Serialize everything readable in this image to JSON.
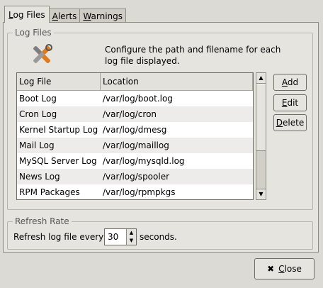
{
  "tabs": [
    {
      "label_ul": "L",
      "label_rest": "og Files"
    },
    {
      "label_ul": "A",
      "label_rest": "lerts"
    },
    {
      "label_ul": "W",
      "label_rest": "arnings"
    }
  ],
  "log_files_group": {
    "title": "Log Files",
    "description": "Configure the path and filename for each log file displayed.",
    "columns": [
      "Log File",
      "Location"
    ],
    "rows": [
      {
        "name": "Boot Log",
        "location": "/var/log/boot.log"
      },
      {
        "name": "Cron Log",
        "location": "/var/log/cron"
      },
      {
        "name": "Kernel Startup Log",
        "location": "/var/log/dmesg"
      },
      {
        "name": "Mail Log",
        "location": "/var/log/maillog"
      },
      {
        "name": "MySQL Server Log",
        "location": "/var/log/mysqld.log"
      },
      {
        "name": "News Log",
        "location": "/var/log/spooler"
      },
      {
        "name": "RPM Packages",
        "location": "/var/log/rpmpkgs"
      }
    ],
    "buttons": {
      "add_ul": "A",
      "add_rest": "dd",
      "edit_ul": "E",
      "edit_rest": "dit",
      "delete_ul": "D",
      "delete_rest": "elete"
    }
  },
  "refresh_group": {
    "title": "Refresh Rate",
    "label": "Refresh log file every",
    "value": "30",
    "unit": "seconds."
  },
  "close_button": {
    "icon": "close-icon",
    "ul": "C",
    "rest": "lose"
  }
}
